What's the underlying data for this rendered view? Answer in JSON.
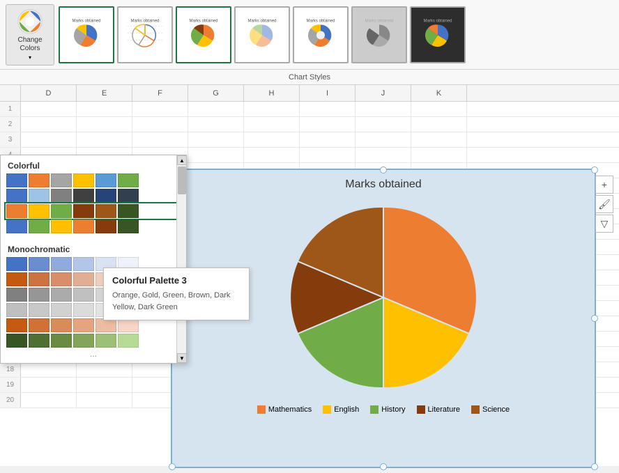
{
  "toolbar": {
    "change_colors_label": "Change Colors",
    "chart_styles_label": "Chart Styles",
    "change_colors_dropdown_indicator": "▾"
  },
  "color_picker": {
    "colorful_label": "Colorful",
    "monochromatic_label": "Monochromatic",
    "more_indicator": "...",
    "colorful_rows": [
      [
        "#4472C4",
        "#ED7D31",
        "#A5A5A5",
        "#FFC000",
        "#5B9BD5",
        "#70AD47"
      ],
      [
        "#4472C4",
        "#9DC3E6",
        "#808080",
        "#404040",
        "#264478",
        "#323F4F"
      ],
      [
        "#ED7D31",
        "#FFC000",
        "#70AD47",
        "#843C0C",
        "#9E5718",
        "#375623"
      ],
      [
        "#4472C4",
        "#70AD47",
        "#FFC000",
        "#ED7D31",
        "#843C0C",
        "#375623"
      ]
    ],
    "monochromatic_rows": [
      [
        "#4472C4",
        "#698DCF",
        "#8FAADC",
        "#B4C6E7",
        "#D9E2F3",
        "#EEF3FA"
      ],
      [
        "#C45911",
        "#CD7241",
        "#D98D6A",
        "#E2AE93",
        "#EDCFBB",
        "#F8EFEA"
      ],
      [
        "#808080",
        "#969696",
        "#ABABAB",
        "#C0C0C0",
        "#D4D4D4",
        "#EBEBEB"
      ],
      [
        "#BFBFBF",
        "#C8C8C8",
        "#D1D1D1",
        "#DBDBDB",
        "#E4E4E4",
        "#EEEEEE"
      ],
      [
        "#C55A11",
        "#D07235",
        "#DA8B5A",
        "#E4A47F",
        "#EDBDA3",
        "#F7D6C8"
      ],
      [
        "#375623",
        "#4F7032",
        "#698B42",
        "#83A55A",
        "#9DC078",
        "#B7DB97"
      ]
    ],
    "active_row_index": 2
  },
  "tooltip": {
    "title": "Colorful Palette 3",
    "description": "Orange, Gold, Green, Brown, Dark Yellow, Dark Green"
  },
  "chart": {
    "title": "Marks obtained",
    "legend": [
      {
        "label": "Mathematics",
        "color": "#ED7D31"
      },
      {
        "label": "English",
        "color": "#FFC000"
      },
      {
        "label": "History",
        "color": "#70AD47"
      },
      {
        "label": "Literature",
        "color": "#843C0C"
      },
      {
        "label": "Science",
        "color": "#9E5718"
      }
    ]
  },
  "grid": {
    "columns": [
      "D",
      "E",
      "F",
      "G",
      "H",
      "I",
      "J",
      "K"
    ],
    "rows": 20
  },
  "side_icons": [
    "+",
    "✏",
    "▽"
  ]
}
